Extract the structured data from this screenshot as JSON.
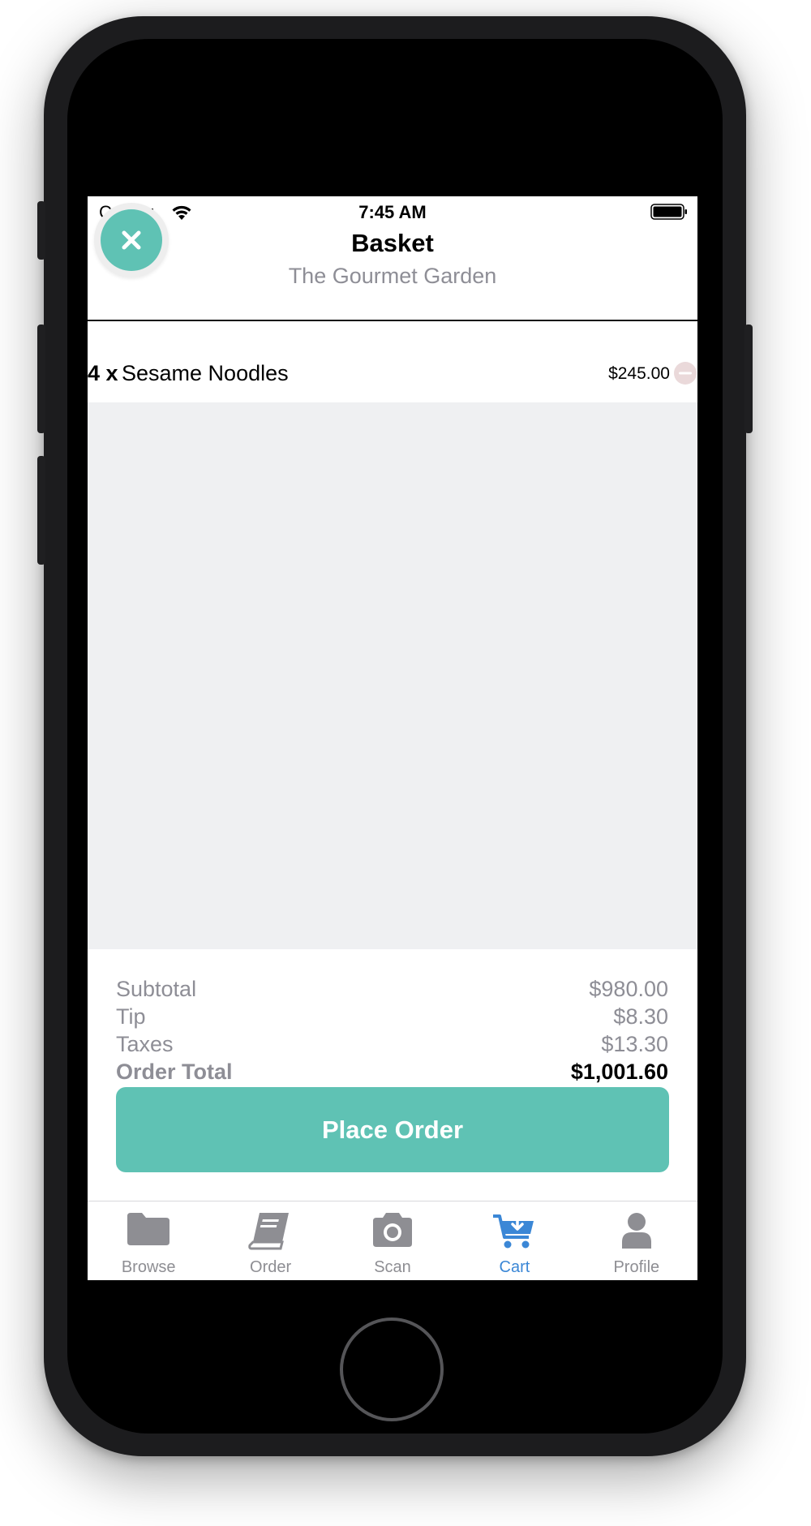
{
  "status_bar": {
    "carrier": "Carrier",
    "time": "7:45 AM"
  },
  "header": {
    "title": "Basket",
    "restaurant": "The Gourmet Garden",
    "close_icon": "close-icon"
  },
  "items": [
    {
      "quantity": "4 x",
      "name": "Sesame Noodles",
      "price": "$245.00",
      "remove_icon": "minus-circle-icon"
    }
  ],
  "summary": {
    "subtotal_label": "Subtotal",
    "subtotal_value": "$980.00",
    "tip_label": "Tip",
    "tip_value": "$8.30",
    "taxes_label": "Taxes",
    "taxes_value": "$13.30",
    "total_label": "Order Total",
    "total_value": "$1,001.60"
  },
  "place_order_label": "Place Order",
  "tabs": [
    {
      "label": "Browse",
      "icon": "folder-icon",
      "active": false
    },
    {
      "label": "Order",
      "icon": "book-icon",
      "active": false
    },
    {
      "label": "Scan",
      "icon": "camera-icon",
      "active": false
    },
    {
      "label": "Cart",
      "icon": "cart-icon",
      "active": true
    },
    {
      "label": "Profile",
      "icon": "person-icon",
      "active": false
    }
  ],
  "colors": {
    "accent": "#5fc2b4",
    "active_tab": "#3b87d6",
    "inactive_tab": "#8e8e93",
    "muted_text": "#8e8e96",
    "list_background": "#eff0f2"
  }
}
